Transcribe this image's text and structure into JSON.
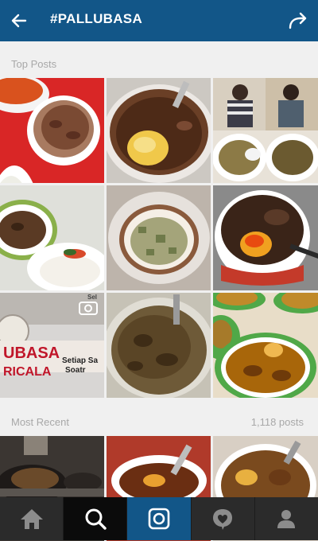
{
  "header": {
    "title": "#PALLUBASA"
  },
  "sections": {
    "top_posts_label": "Top Posts",
    "most_recent_label": "Most Recent",
    "post_count": "1,118 posts"
  },
  "tile_texts": {
    "banner_line1": "UBASA",
    "banner_line2": "RICALA",
    "banner_small1": "Setiap Sa",
    "banner_small2": "Soatr",
    "banner_corner": "Sel"
  },
  "icons": {
    "back": "arrow-left-icon",
    "share": "share-arrow-icon",
    "home": "home-icon",
    "search": "search-icon",
    "camera": "camera-icon",
    "activity": "activity-heart-icon",
    "profile": "profile-icon",
    "video": "video-icon"
  },
  "colors": {
    "brand": "#125688",
    "nav": "#2b2b2b",
    "label": "#a8a8a8"
  }
}
